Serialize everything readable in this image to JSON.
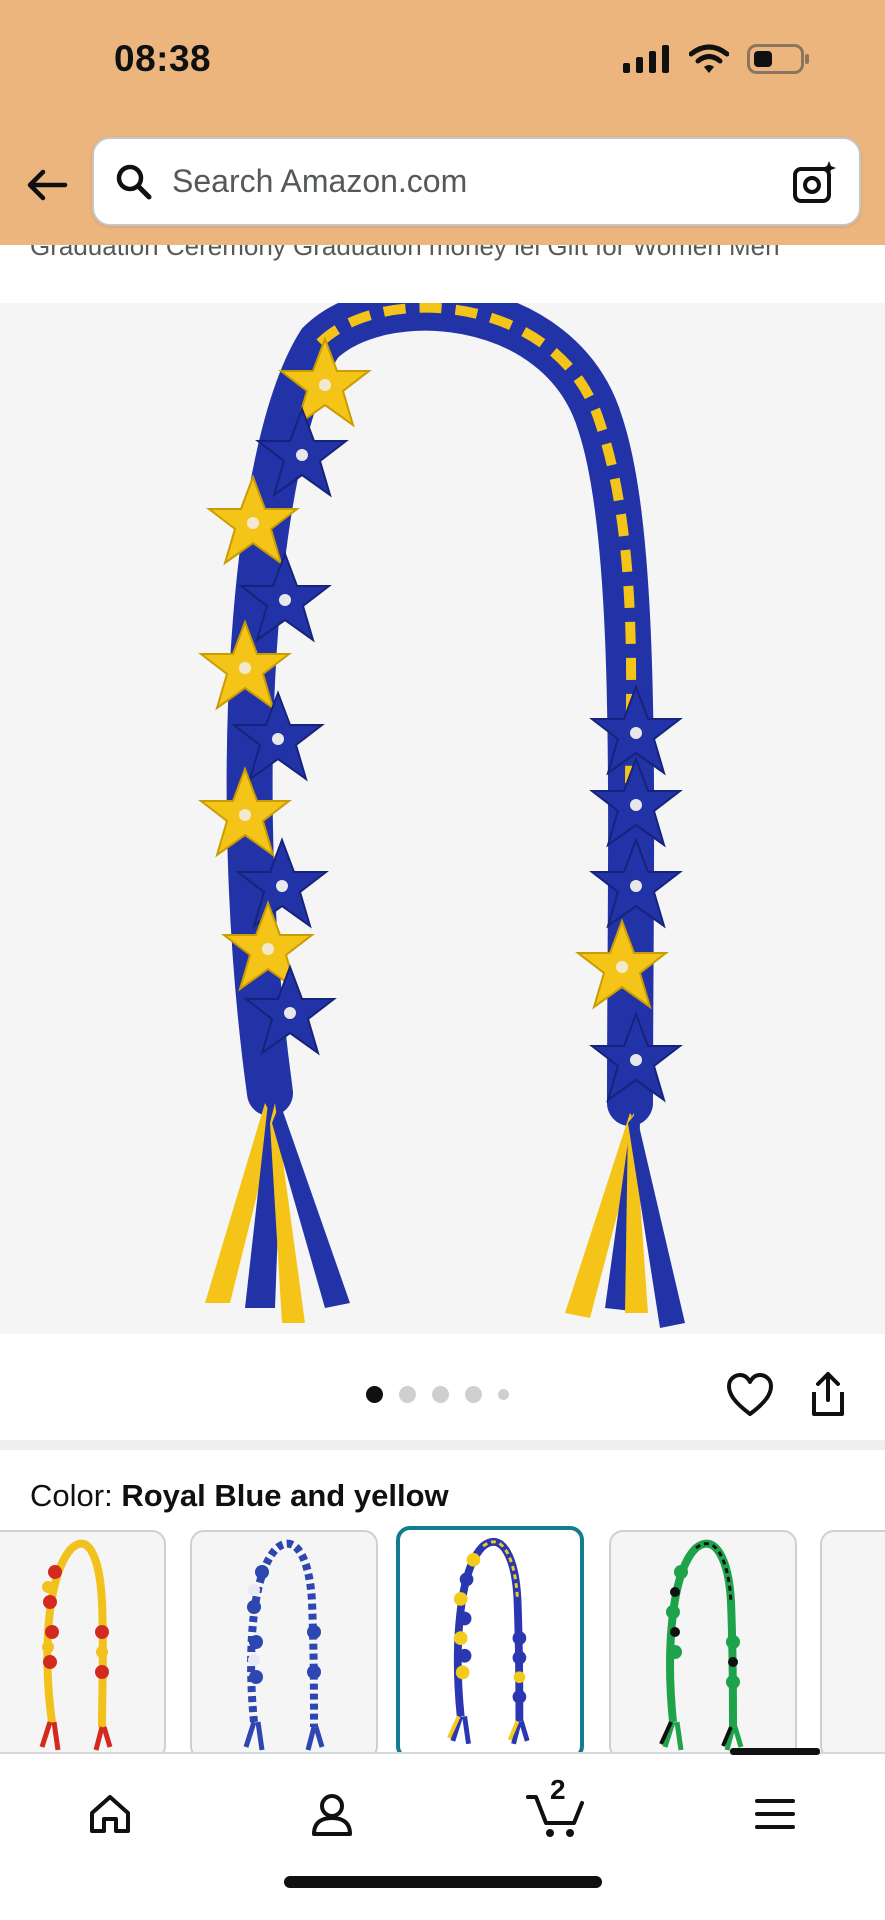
{
  "status_bar": {
    "time": "08:38"
  },
  "search": {
    "placeholder": "Search Amazon.com"
  },
  "product": {
    "title_partial": "Graduation Ceremony Graduation money lei Gift for Women Men"
  },
  "carousel": {
    "total_dots": 5,
    "active_index": 0
  },
  "color": {
    "label": "Color: ",
    "value": "Royal Blue and yellow"
  },
  "swatches": [
    {
      "colors": [
        "#d32a1f",
        "#f1c21b"
      ]
    },
    {
      "colors": [
        "#2d46b0",
        "#ffffff"
      ]
    },
    {
      "colors": [
        "#2a37b0",
        "#f2cb1d"
      ],
      "selected": true
    },
    {
      "colors": [
        "#1fa34a",
        "#101010"
      ]
    },
    {
      "colors": []
    }
  ],
  "nav": {
    "cart_count": "2"
  },
  "colors": {
    "header": "#edb57e",
    "selected_swatch": "#147c8f",
    "royal_blue": "#2233a8",
    "yellow": "#f4c518"
  }
}
